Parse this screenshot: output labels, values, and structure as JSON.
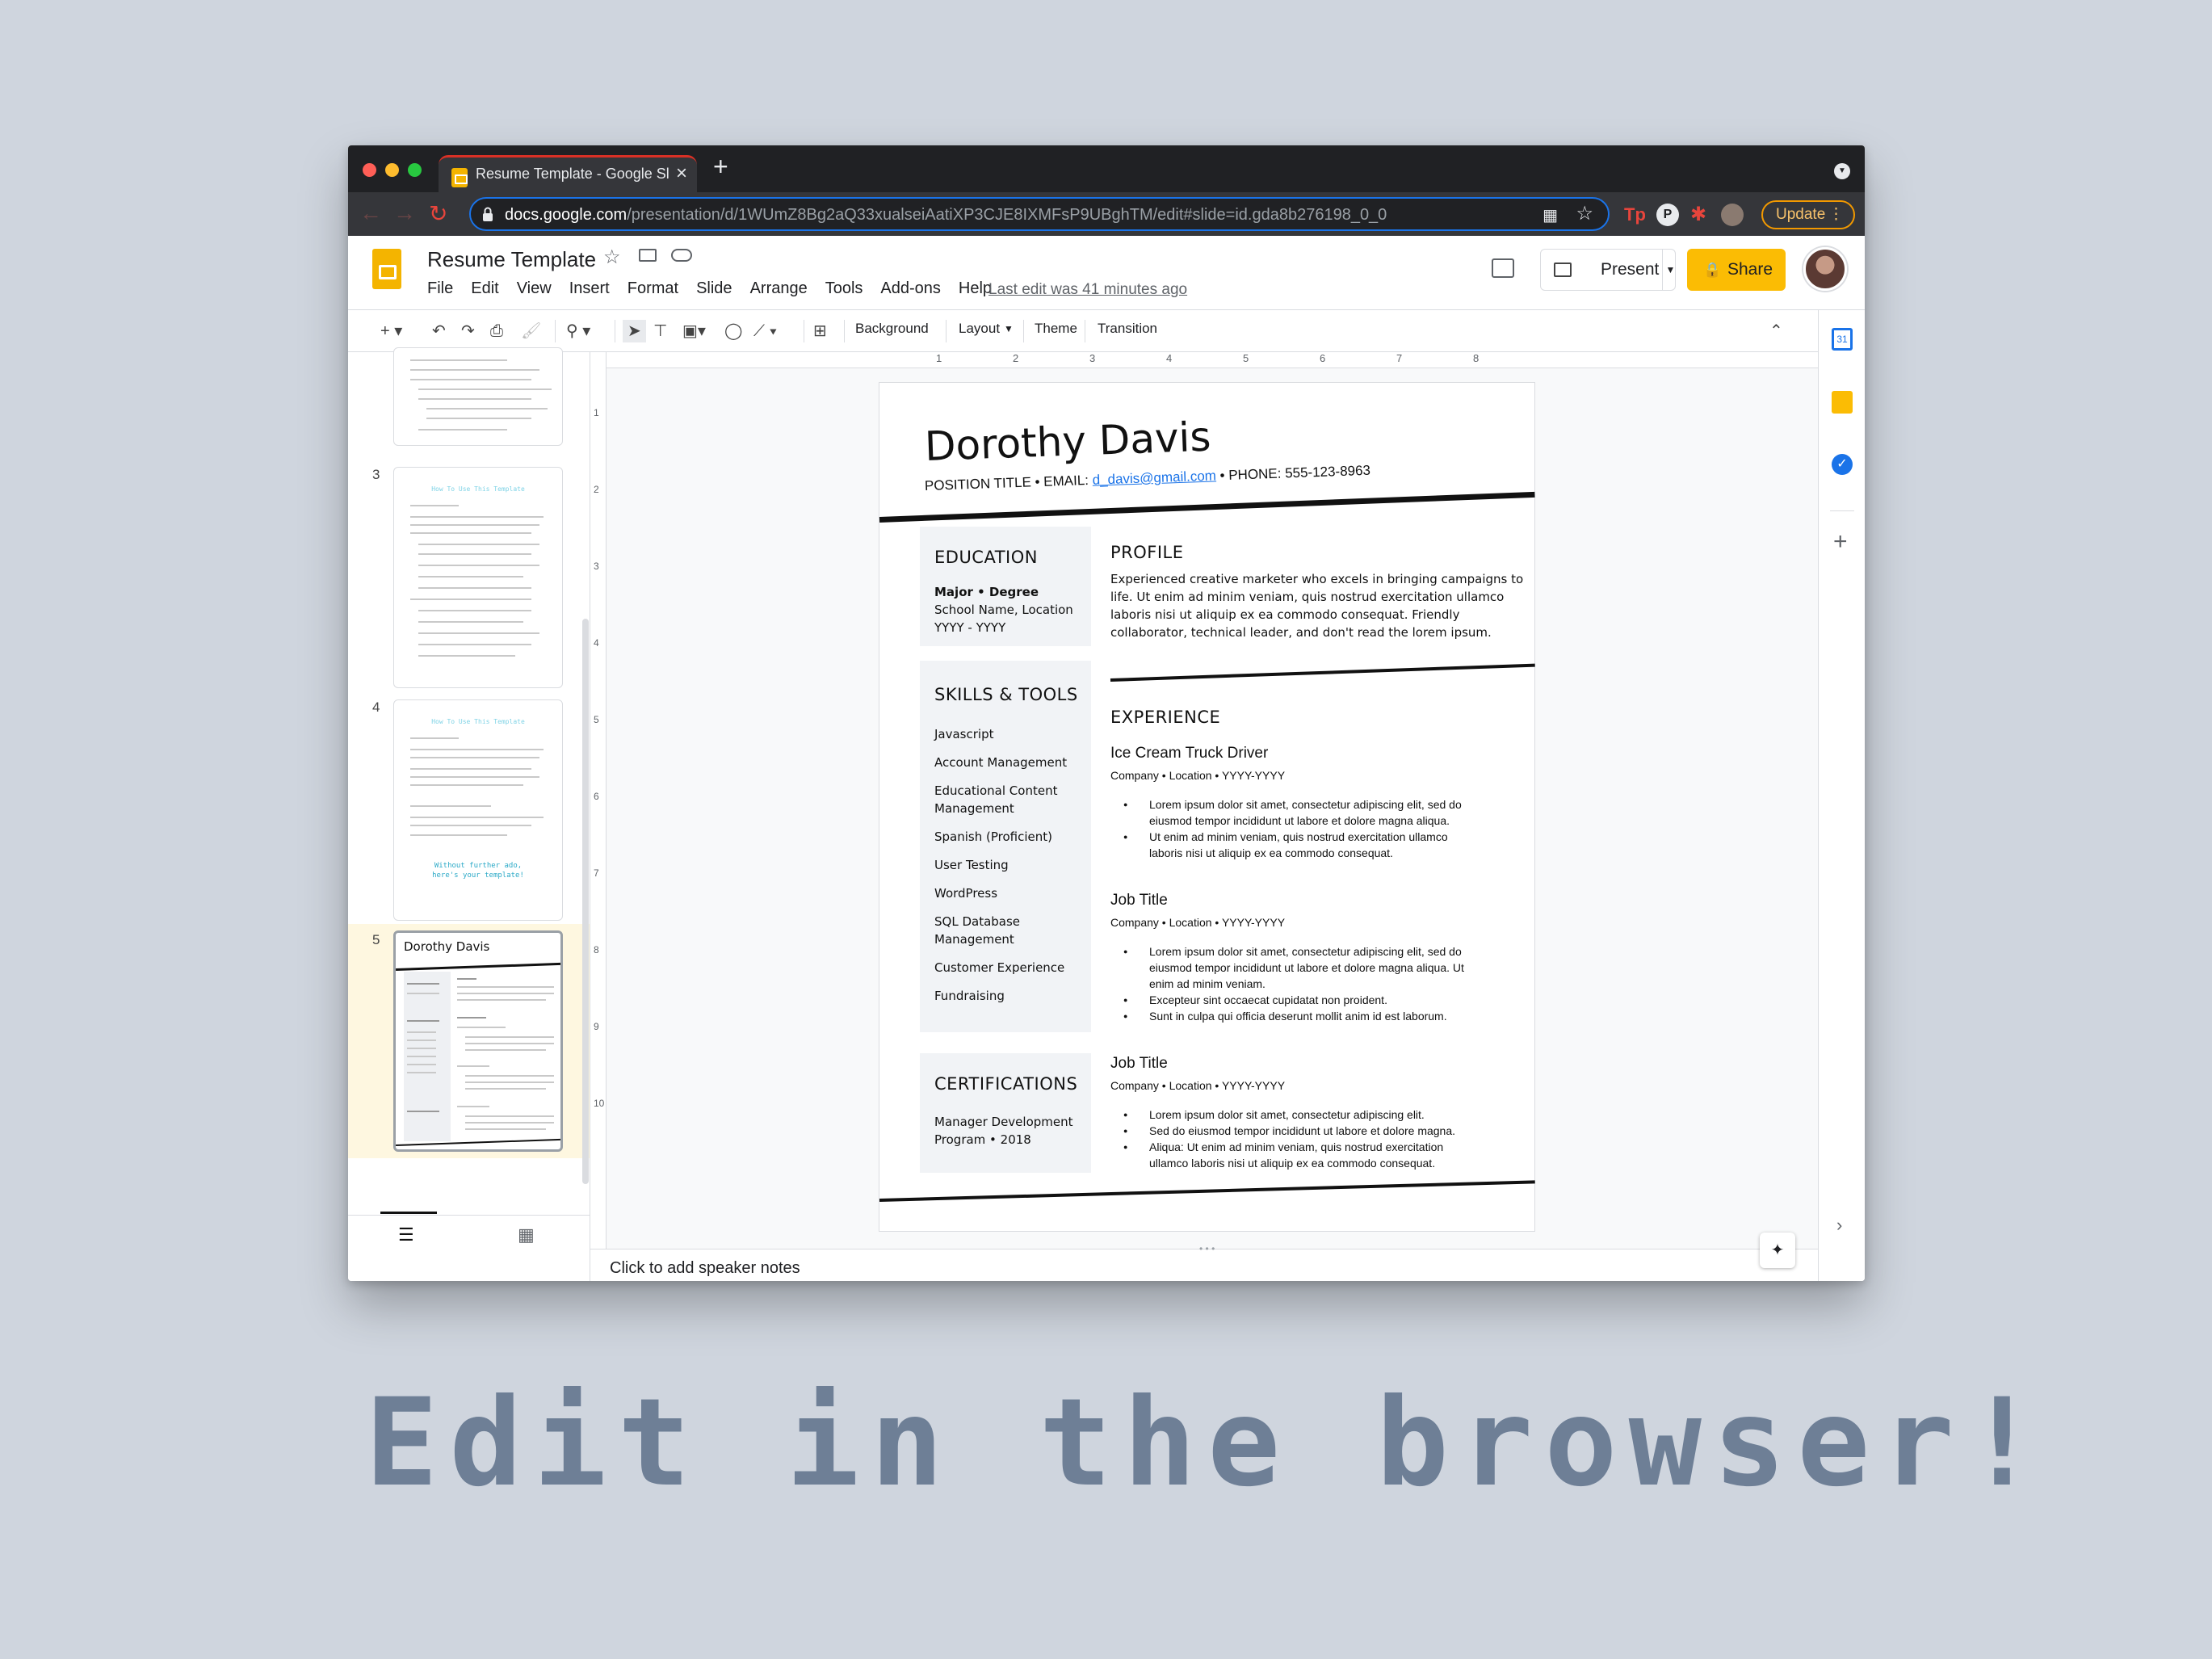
{
  "browser": {
    "tab_title": "Resume Template - Google Slides",
    "new_tab": "+",
    "close_tab": "×",
    "url_domain": "docs.google.com",
    "url_path": "/presentation/d/1WUmZ8Bg2aQ33xualseiAatiXP3CJE8IXMFsP9UBghTM/edit#slide=id.gda8b276198_0_0",
    "update_label": "Update"
  },
  "app": {
    "doc_title": "Resume Template",
    "menus": [
      "File",
      "Edit",
      "View",
      "Insert",
      "Format",
      "Slide",
      "Arrange",
      "Tools",
      "Add-ons",
      "Help"
    ],
    "last_edit": "Last edit was 41 minutes ago",
    "present_label": "Present",
    "share_label": "Share"
  },
  "toolbar": {
    "background": "Background",
    "layout": "Layout",
    "theme": "Theme",
    "transition": "Transition"
  },
  "filmstrip": {
    "numbers": [
      "3",
      "4",
      "5"
    ],
    "thumb3_title": "How To Use This Template",
    "thumb4_title": "How To Use This Template",
    "thumb4_callout_1": "Without further ado,",
    "thumb4_callout_2": "here's your template!",
    "thumb5_name": "Dorothy Davis"
  },
  "ruler_numbers": [
    "1",
    "2",
    "3",
    "4",
    "5",
    "6",
    "7",
    "8"
  ],
  "vruler_numbers": [
    "1",
    "2",
    "3",
    "4",
    "5",
    "6",
    "7",
    "8",
    "9",
    "10"
  ],
  "resume": {
    "name": "Dorothy Davis",
    "contact_prefix": "POSITION TITLE • EMAIL: ",
    "email": "d_davis@gmail.com",
    "contact_suffix": " • PHONE: 555-123-8963",
    "education": {
      "heading": "EDUCATION",
      "degree": "Major • Degree",
      "school": "School Name, Location",
      "years": "YYYY - YYYY"
    },
    "skills": {
      "heading": "SKILLS & TOOLS",
      "items": [
        "Javascript",
        "Account Management",
        "Educational Content",
        "Management",
        "Spanish (Proficient)",
        "User Testing",
        "WordPress",
        "SQL Database",
        "Management",
        "Customer Experience",
        "Fundraising"
      ]
    },
    "certifications": {
      "heading": "CERTIFICATIONS",
      "line1": "Manager Development",
      "line2": "Program • 2018"
    },
    "profile": {
      "heading": "PROFILE",
      "lines": [
        "Experienced creative marketer who excels in bringing campaigns to",
        "life. Ut enim ad minim veniam, quis nostrud exercitation ullamco",
        "laboris nisi ut aliquip ex ea commodo consequat. Friendly",
        "collaborator, technical leader, and don't read the lorem ipsum."
      ]
    },
    "experience_heading": "EXPERIENCE",
    "jobs": [
      {
        "title": "Ice Cream Truck Driver",
        "meta": "Company  • Location • YYYY-YYYY",
        "bullets": [
          [
            "Lorem ipsum dolor sit amet, consectetur adipiscing elit, sed do",
            "eiusmod tempor incididunt ut labore et dolore magna aliqua."
          ],
          [
            "Ut enim ad minim veniam, quis nostrud exercitation ullamco",
            "laboris nisi ut aliquip ex ea commodo consequat."
          ]
        ]
      },
      {
        "title": "Job Title",
        "meta": "Company  • Location • YYYY-YYYY",
        "bullets": [
          [
            "Lorem ipsum dolor sit amet, consectetur adipiscing elit, sed do",
            "eiusmod tempor incididunt ut labore et dolore magna aliqua. Ut",
            "enim ad minim veniam."
          ],
          [
            "Excepteur sint occaecat cupidatat non proident."
          ],
          [
            "Sunt in culpa qui officia deserunt mollit anim id est laborum."
          ]
        ]
      },
      {
        "title": "Job Title",
        "meta": "Company  • Location • YYYY-YYYY",
        "bullets": [
          [
            "Lorem ipsum dolor sit amet, consectetur adipiscing elit."
          ],
          [
            "Sed do eiusmod tempor incididunt ut labore et dolore magna."
          ],
          [
            "Aliqua: Ut enim ad minim veniam, quis nostrud exercitation",
            "ullamco laboris nisi ut aliquip ex ea commodo consequat."
          ]
        ]
      }
    ]
  },
  "speaker_notes": "Click to add speaker notes",
  "caption": "Edit in the browser!",
  "colors": {
    "accent": "#fbbc04",
    "link": "#1a73e8",
    "caption": "#6e7f96"
  }
}
